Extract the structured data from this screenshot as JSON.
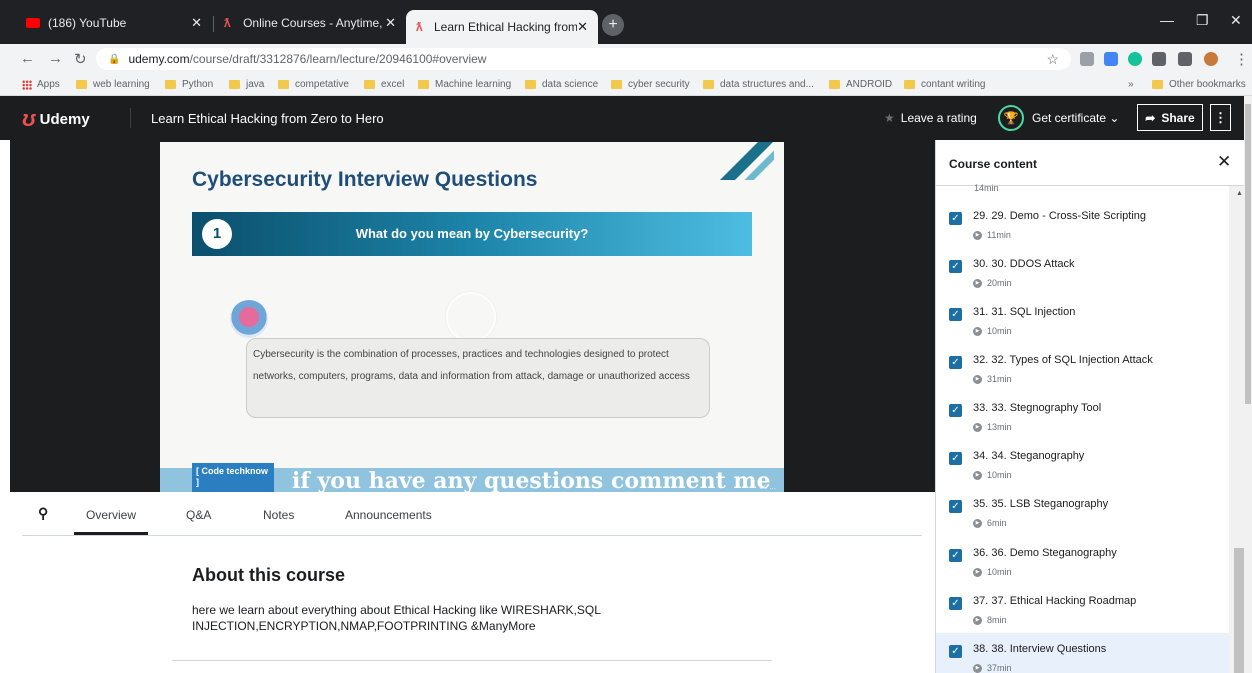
{
  "browser": {
    "tabs": [
      {
        "title": "(186) YouTube",
        "icon": "youtube-icon"
      },
      {
        "title": "Online Courses - Anytime, Anywh",
        "icon": "udemy-icon"
      },
      {
        "title": "Learn Ethical Hacking from Zero",
        "icon": "udemy-icon"
      }
    ],
    "url_domain": "udemy.com",
    "url_path": "/course/draft/3312876/learn/lecture/20946100#overview",
    "bookmarks": [
      "Apps",
      "web learning",
      "Python",
      "java",
      "competative",
      "excel",
      "Machine learning",
      "data science",
      "cyber security",
      "data structures and...",
      "ANDROID",
      "contant writing"
    ],
    "bookmarks_overflow": "»",
    "other_bookmarks": "Other bookmarks"
  },
  "header": {
    "brand": "Udemy",
    "course_title": "Learn Ethical Hacking from Zero to Hero",
    "leave_rating": "Leave a rating",
    "get_certificate": "Get certificate",
    "share": "Share"
  },
  "slide": {
    "title": "Cybersecurity Interview Questions",
    "question_number": "1",
    "question": "What do you mean by Cybersecurity?",
    "answer": "Cybersecurity is the combination of processes, practices and technologies designed to protect networks, computers, programs, data and information from attack, damage or unauthorized access",
    "watermark_label": "[ Code techknow ]",
    "watermark_text": "if you have any questions comment me",
    "cc": "cc ..."
  },
  "lower_tabs": {
    "overview": "Overview",
    "qa": "Q&A",
    "notes": "Notes",
    "announcements": "Announcements"
  },
  "about": {
    "title": "About this course",
    "description": "here we learn about everything about Ethical Hacking like WIRESHARK,SQL INJECTION,ENCRYPTION,NMAP,FOOTPRINTING &ManyMore"
  },
  "sidebar": {
    "title": "Course content",
    "partial_duration": "14min",
    "lectures": [
      {
        "title": "29. 29. Demo - Cross-Site Scripting",
        "duration": "11min",
        "completed": true
      },
      {
        "title": "30. 30. DDOS Attack",
        "duration": "20min",
        "completed": true
      },
      {
        "title": "31. 31. SQL Injection",
        "duration": "10min",
        "completed": true
      },
      {
        "title": "32. 32. Types of SQL Injection Attack",
        "duration": "31min",
        "completed": true
      },
      {
        "title": "33. 33. Stegnography Tool",
        "duration": "13min",
        "completed": true
      },
      {
        "title": "34. 34. Steganography",
        "duration": "10min",
        "completed": true
      },
      {
        "title": "35. 35. LSB Steganography",
        "duration": "6min",
        "completed": true
      },
      {
        "title": "36. 36. Demo Steganography",
        "duration": "10min",
        "completed": true
      },
      {
        "title": "37. 37. Ethical Hacking Roadmap",
        "duration": "8min",
        "completed": true
      },
      {
        "title": "38. 38. Interview Questions",
        "duration": "37min",
        "completed": true,
        "current": true
      }
    ]
  },
  "colors": {
    "udemy_dark": "#1c1d1f",
    "udemy_red": "#ec5252",
    "check_blue": "#1c6ea4",
    "certificate_green": "#4ad7a4"
  }
}
